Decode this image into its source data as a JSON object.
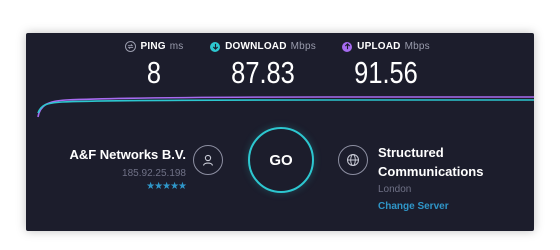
{
  "metrics": {
    "ping": {
      "label": "PING",
      "unit": "ms",
      "value": "8",
      "icon": "ping-icon",
      "color": "#9a9cad"
    },
    "download": {
      "label": "DOWNLOAD",
      "unit": "Mbps",
      "value": "87.83",
      "icon": "download-icon",
      "color": "#2dc7d0"
    },
    "upload": {
      "label": "UPLOAD",
      "unit": "Mbps",
      "value": "91.56",
      "icon": "upload-icon",
      "color": "#a66bf0"
    }
  },
  "isp": {
    "name": "A&F Networks B.V.",
    "ip": "185.92.25.198",
    "rating": "★★★★★"
  },
  "go_button": {
    "label": "GO"
  },
  "server": {
    "name": "Structured Communications",
    "city": "London",
    "change_label": "Change Server"
  },
  "colors": {
    "background": "#1c1d2c",
    "accent_download": "#2dc7d0",
    "accent_upload": "#a66bf0",
    "link": "#2f96c8"
  }
}
